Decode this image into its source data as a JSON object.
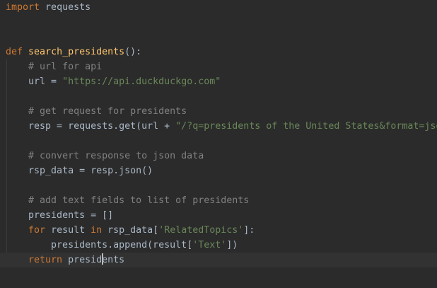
{
  "code": {
    "line1": {
      "keyword": "import",
      "rest": " requests"
    },
    "line4": {
      "keyword": "def",
      "space": " ",
      "fn_name": "search_presidents",
      "rest": "():"
    },
    "line5": {
      "indent": "    ",
      "comment": "# url for api"
    },
    "line6": {
      "indent": "    ",
      "lhs": "url = ",
      "string": "\"https://api.duckduckgo.com\""
    },
    "line8": {
      "indent": "    ",
      "comment": "# get request for presidents"
    },
    "line9": {
      "indent": "    ",
      "lhs": "resp = requests.get(url + ",
      "string": "\"/?q=presidents of the United States&format=json\""
    },
    "line11": {
      "indent": "    ",
      "comment": "# convert response to json data"
    },
    "line12": {
      "indent": "    ",
      "code": "rsp_data = resp.json()"
    },
    "line14": {
      "indent": "    ",
      "comment": "# add text fields to list of presidents"
    },
    "line15": {
      "indent": "    ",
      "code": "presidents = []"
    },
    "line16": {
      "indent": "    ",
      "keyword": "for",
      "mid1": " result ",
      "keyword2": "in",
      "mid2": " rsp_data[",
      "string": "'RelatedTopics'",
      "end": "]:"
    },
    "line17": {
      "indent": "        ",
      "pre": "presidents.append(result[",
      "string": "'Text'",
      "end": "])"
    },
    "line18": {
      "indent": "    ",
      "keyword": "return",
      "space": " ",
      "before_caret": "presid",
      "after_caret": "ents"
    }
  }
}
